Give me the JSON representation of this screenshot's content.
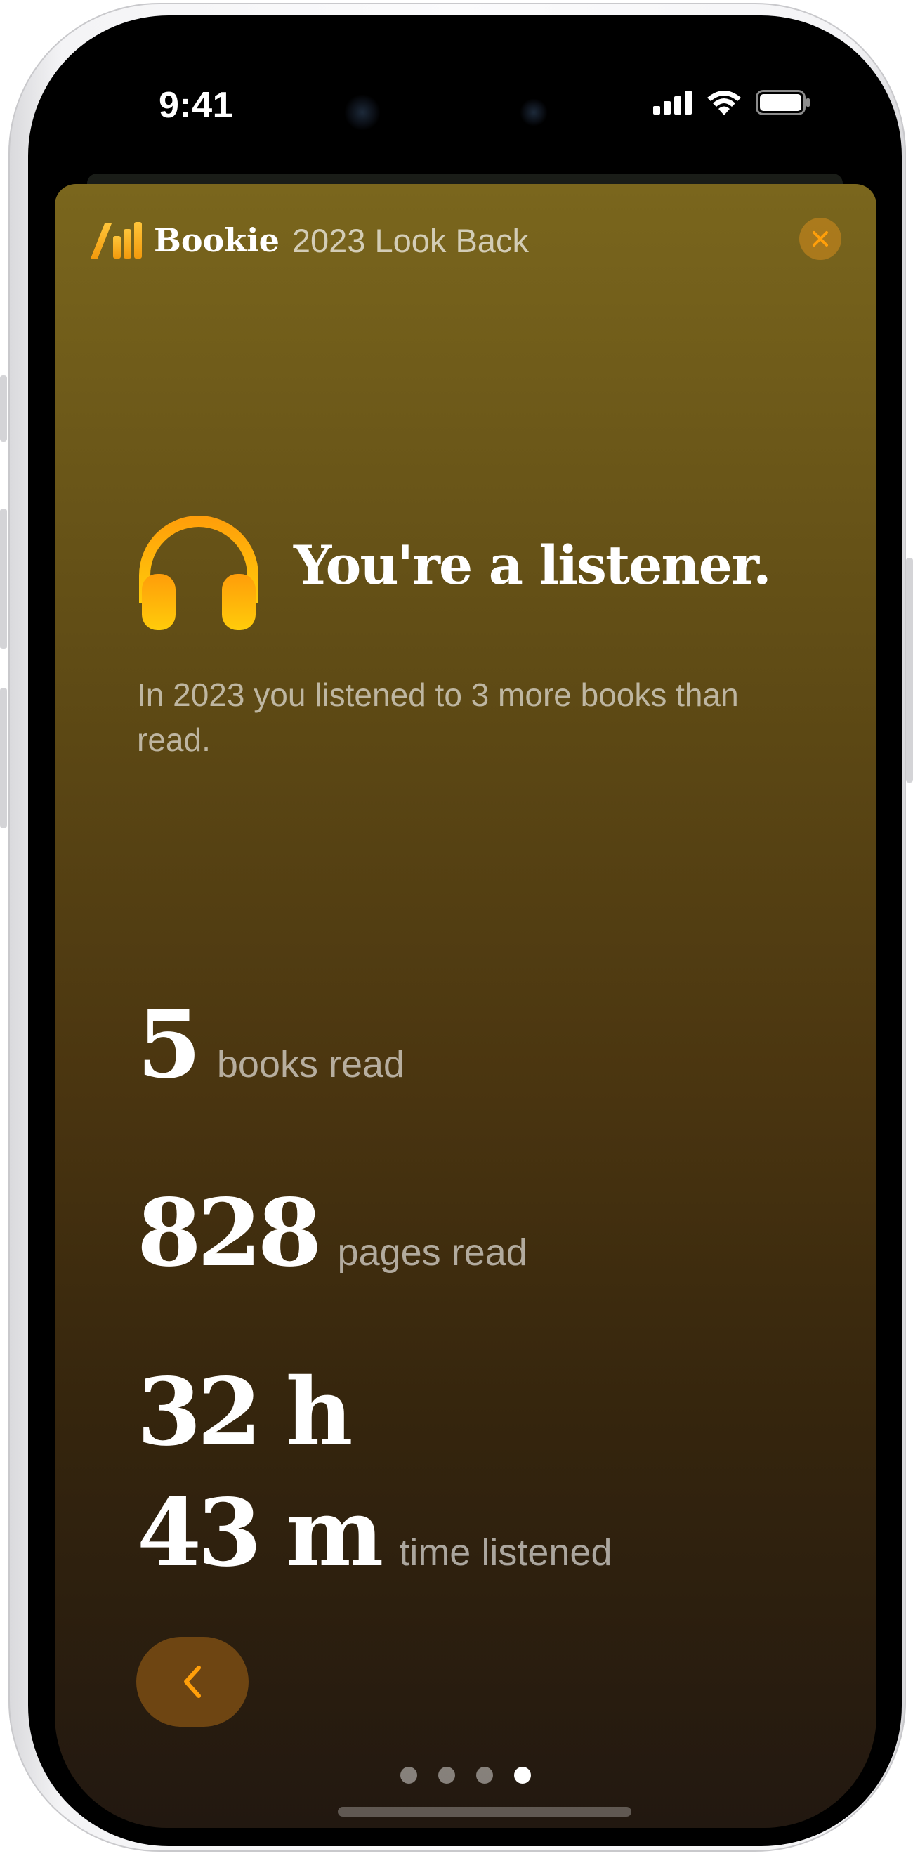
{
  "status_bar": {
    "time": "9:41",
    "icons": [
      "cellular-signal-icon",
      "wifi-icon",
      "battery-icon"
    ]
  },
  "header": {
    "brand": "Bookie",
    "subtitle": "2023 Look Back",
    "close_icon": "close-icon",
    "logo_icon": "bookie-logo-icon"
  },
  "hero": {
    "icon": "headphones-icon",
    "title": "You're a listener.",
    "description": "In 2023 you listened to 3 more books than read."
  },
  "stats": {
    "books": {
      "value": "5",
      "label": "books read"
    },
    "pages": {
      "value": "828",
      "label": "pages read"
    },
    "time": {
      "hours": "32 h",
      "minutes": "43 m",
      "label": "time listened"
    }
  },
  "navigation": {
    "back_icon": "chevron-left-icon",
    "page_count": 4,
    "current_page": 4
  },
  "colors": {
    "accent": "#ff9f0a",
    "gradient_top": "#7a661d",
    "gradient_bottom": "#221810",
    "back_button_bg": "#6e4512"
  }
}
